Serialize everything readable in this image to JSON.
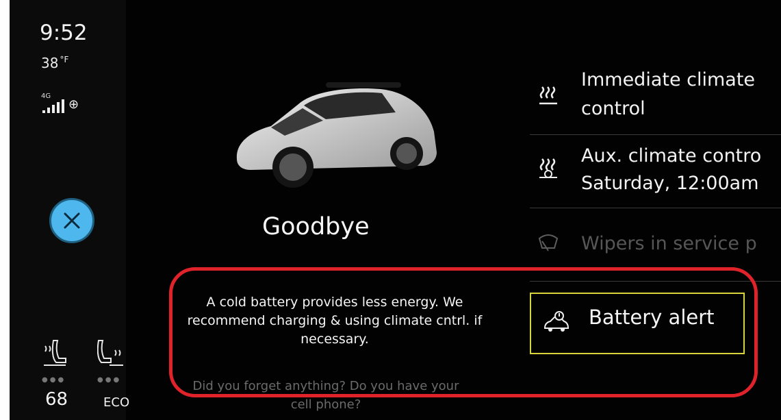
{
  "status": {
    "time": "9:52",
    "temperature": "38",
    "temperature_unit": "°F",
    "network": "4G"
  },
  "vehicle": {
    "greeting": "Goodbye",
    "alert_message": "A cold battery provides less energy. We recommend charging & using climate cntrl. if necessary.",
    "reminder_message": "Did you forget anything? Do you have your cell phone?"
  },
  "menu": {
    "items": [
      {
        "label_line1": "Immediate climate",
        "label_line2": "control",
        "icon": "heat-waves-icon"
      },
      {
        "label_line1": "Aux. climate contro",
        "label_line2": "Saturday, 12:00am",
        "icon": "aux-climate-icon"
      },
      {
        "label_line1": "Wipers in service p",
        "icon": "wiper-icon"
      }
    ],
    "battery_alert": {
      "label": "Battery alert",
      "icon": "battery-alert-icon"
    }
  },
  "seats": {
    "left_value": "68",
    "right_value": "ECO"
  },
  "colors": {
    "accent_close": "#4db7ee",
    "highlight_ring": "#e0232b",
    "battery_box_border": "#d8d63a"
  }
}
